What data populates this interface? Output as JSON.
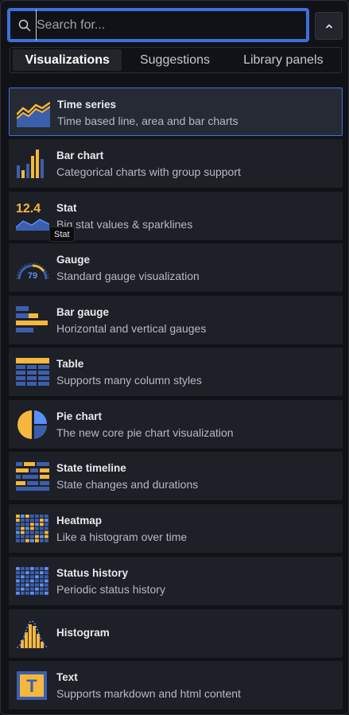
{
  "search": {
    "placeholder": "Search for...",
    "value": ""
  },
  "tabs": [
    {
      "label": "Visualizations",
      "active": true
    },
    {
      "label": "Suggestions",
      "active": false
    },
    {
      "label": "Library panels",
      "active": false
    }
  ],
  "items": [
    {
      "id": "timeseries",
      "title": "Time series",
      "description": "Time based line, area and bar charts",
      "icon": "time-series-icon",
      "selected": true
    },
    {
      "id": "barchart",
      "title": "Bar chart",
      "description": "Categorical charts with group support",
      "icon": "bar-chart-icon"
    },
    {
      "id": "stat",
      "title": "Stat",
      "description": "Big stat values & sparklines",
      "icon": "stat-icon",
      "icon_text": "12.4"
    },
    {
      "id": "gauge",
      "title": "Gauge",
      "description": "Standard gauge visualization",
      "icon": "gauge-icon",
      "icon_text": "79"
    },
    {
      "id": "bargauge",
      "title": "Bar gauge",
      "description": "Horizontal and vertical gauges",
      "icon": "bar-gauge-icon"
    },
    {
      "id": "table",
      "title": "Table",
      "description": "Supports many column styles",
      "icon": "table-icon"
    },
    {
      "id": "piechart",
      "title": "Pie chart",
      "description": "The new core pie chart visualization",
      "icon": "pie-chart-icon"
    },
    {
      "id": "statetimeline",
      "title": "State timeline",
      "description": "State changes and durations",
      "icon": "state-timeline-icon"
    },
    {
      "id": "heatmap",
      "title": "Heatmap",
      "description": "Like a histogram over time",
      "icon": "heatmap-icon"
    },
    {
      "id": "statushistory",
      "title": "Status history",
      "description": "Periodic status history",
      "icon": "status-history-icon"
    },
    {
      "id": "histogram",
      "title": "Histogram",
      "description": "",
      "icon": "histogram-icon"
    },
    {
      "id": "text",
      "title": "Text",
      "description": "Supports markdown and html content",
      "icon": "text-icon",
      "icon_text": "T"
    }
  ],
  "tooltip": {
    "text": "Stat"
  },
  "colors": {
    "accent": "#3d71d9",
    "yellow": "#f5b73d",
    "blue": "#5b8ff9",
    "dark_blue": "#3c5fad"
  }
}
